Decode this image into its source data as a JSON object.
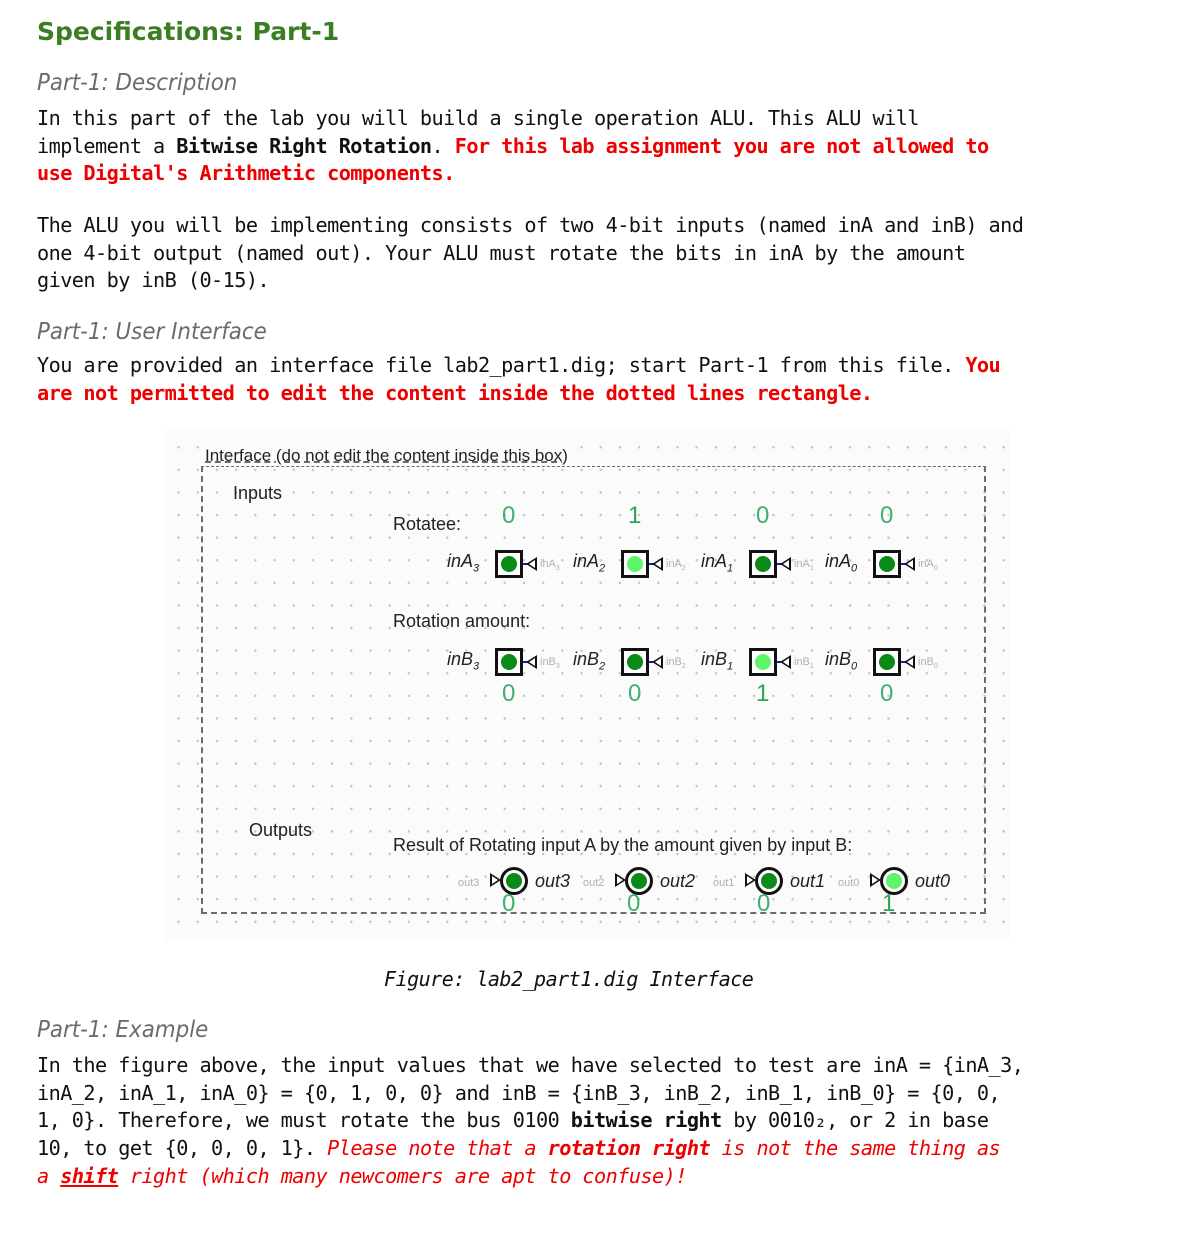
{
  "heading": "Specifications: Part-1",
  "description": {
    "title": "Part-1: Description",
    "p1_a": "In this part of the lab you will build a single operation ALU. This ALU will\nimplement a ",
    "p1_bold": "Bitwise Right Rotation",
    "p1_b": ". ",
    "p1_red": "For this lab assignment you are not allowed to\nuse Digital's Arithmetic components.",
    "p2": "The ALU you will be implementing consists of two 4-bit inputs (named inA and inB) and\none 4-bit output (named out). Your ALU must rotate the bits in inA by the amount\ngiven by inB (0-15)."
  },
  "user_interface": {
    "title": "Part-1: User Interface",
    "p_a": "You are provided an interface file lab2_part1.dig; start Part-1 from this file. ",
    "p_red": "You\nare not permitted to edit the content inside the dotted lines rectangle."
  },
  "figure": {
    "box_title": "Interface (do not edit the content inside this box)",
    "inputs_label": "Inputs",
    "rotatee_label": "Rotatee:",
    "rotation_label": "Rotation amount:",
    "outputs_label": "Outputs",
    "result_label": "Result of Rotating input A by the amount given by input B:",
    "inA": [
      {
        "name": "inA",
        "sub": "3",
        "value": "0",
        "on": false
      },
      {
        "name": "inA",
        "sub": "2",
        "value": "1",
        "on": true
      },
      {
        "name": "inA",
        "sub": "1",
        "value": "0",
        "on": false
      },
      {
        "name": "inA",
        "sub": "0",
        "value": "0",
        "on": false
      }
    ],
    "inB": [
      {
        "name": "inB",
        "sub": "3",
        "value": "0",
        "on": false
      },
      {
        "name": "inB",
        "sub": "2",
        "value": "0",
        "on": false
      },
      {
        "name": "inB",
        "sub": "1",
        "value": "1",
        "on": true
      },
      {
        "name": "inB",
        "sub": "0",
        "value": "0",
        "on": false
      }
    ],
    "out": [
      {
        "name": "out3",
        "value": "0",
        "on": false
      },
      {
        "name": "out2",
        "value": "0",
        "on": false
      },
      {
        "name": "out1",
        "value": "0",
        "on": false
      },
      {
        "name": "out0",
        "value": "1",
        "on": true
      }
    ],
    "caption": "Figure: lab2_part1.dig Interface"
  },
  "example": {
    "title": "Part-1: Example",
    "p_a": "In the figure above, the input values that we have selected to test are inA = {inA_3,\ninA_2, inA_1, inA_0} = {0, 1, 0, 0} and inB = {inB_3, inB_2, inB_1, inB_0} = {0, 0,\n1, 0}. Therefore, we must rotate the bus 0100 ",
    "p_bold": "bitwise right",
    "p_b": " by 0010₂, or 2 in base\n10, to get {0, 0, 0, 1}. ",
    "note_a": "Please note that a ",
    "note_bold": "rotation right",
    "note_b": " is not the same thing as\na ",
    "note_shift": "shift",
    "note_c": " right (which many newcomers are apt to confuse)!"
  }
}
